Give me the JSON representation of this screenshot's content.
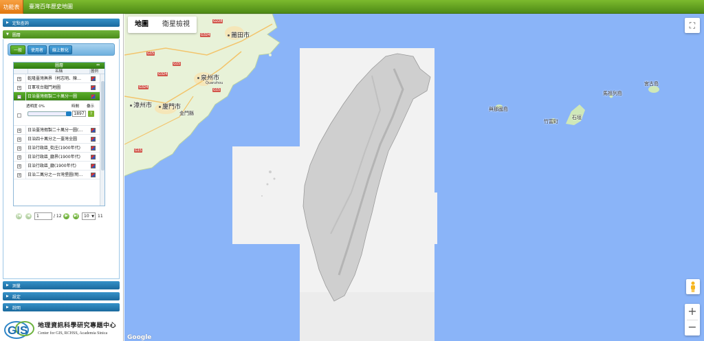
{
  "topbar": {
    "menu_label": "功能表",
    "title": "臺灣百年歷史地圖"
  },
  "sidebar": {
    "sections": [
      {
        "label": "定點查詢",
        "state": "collapsed"
      },
      {
        "label": "圖層",
        "state": "expanded"
      },
      {
        "label": "測量",
        "state": "collapsed"
      },
      {
        "label": "設定",
        "state": "collapsed"
      },
      {
        "label": "說明",
        "state": "collapsed"
      }
    ],
    "tabs": [
      {
        "label": "一般",
        "active": true
      },
      {
        "label": "使用者",
        "active": false
      },
      {
        "label": "線上數化",
        "active": false
      }
    ]
  },
  "layers": {
    "panel_title": "圖層",
    "columns": {
      "name": "名稱",
      "legend": "圖例"
    },
    "rows": [
      {
        "name": "乾隆臺灣輿界（柯志明、陳…",
        "selected": false
      },
      {
        "name": "日軍攻台戰鬥地圖",
        "selected": false
      },
      {
        "name": "日治臺灣假製二十萬分一圖",
        "selected": true
      },
      {
        "name": "日治臺灣假製二十萬分一圖(…",
        "selected": false
      },
      {
        "name": "日治四十萬分之一臺灣全圖",
        "selected": false
      },
      {
        "name": "日治行政區_街庄(1900年代)",
        "selected": false
      },
      {
        "name": "日治行政區_廳界(1900年代)",
        "selected": false
      },
      {
        "name": "日治行政區_廳(1900年代)",
        "selected": false
      },
      {
        "name": "日治二萬分之一台灣堡圖(明…",
        "selected": false
      }
    ],
    "detail": {
      "opacity_label": "透明度 0%",
      "opacity_value": 0,
      "year_label": "時間",
      "visible_label": "疊示",
      "year_value": "1897",
      "help_icon": "?"
    }
  },
  "pager": {
    "current_page": "1",
    "total_pages": "/ 12",
    "page_size": "10",
    "total_records": "11"
  },
  "logo": {
    "mark": "GIS",
    "name_cn": "地理資訊科學研究專題中心",
    "name_en": "Center for GIS, RCHSS, Academia Sinica"
  },
  "map": {
    "type_options": [
      {
        "label": "地圖",
        "active": true
      },
      {
        "label": "衛星檢視",
        "active": false
      }
    ],
    "labels": [
      {
        "text": "莆田市",
        "style": "big"
      },
      {
        "text": "泉州市",
        "style": "big"
      },
      {
        "text": "漳州市",
        "style": "big"
      },
      {
        "text": "廈門市",
        "style": "big"
      },
      {
        "text": "金門縣",
        "style": "small"
      },
      {
        "text": "Quanzhou",
        "style": "small"
      },
      {
        "text": "馬祖列島",
        "style": "small"
      },
      {
        "text": "與那國島",
        "style": "small"
      },
      {
        "text": "石垣",
        "style": "small"
      },
      {
        "text": "竹富町",
        "style": "small"
      },
      {
        "text": "宮古島",
        "style": "small"
      }
    ],
    "highway_shields": [
      "G324",
      "G15",
      "G324",
      "G15",
      "G324",
      "G15",
      "G15",
      "G228"
    ],
    "controls": {
      "fullscreen_icon": "⛶",
      "zoom_in": "+",
      "zoom_out": "−"
    },
    "attribution": "Google",
    "colors": {
      "sea": "#8ab4f8",
      "land": "#e8f2d8",
      "city": "#f5e6b8",
      "overlay": "#f2f2f2"
    }
  }
}
